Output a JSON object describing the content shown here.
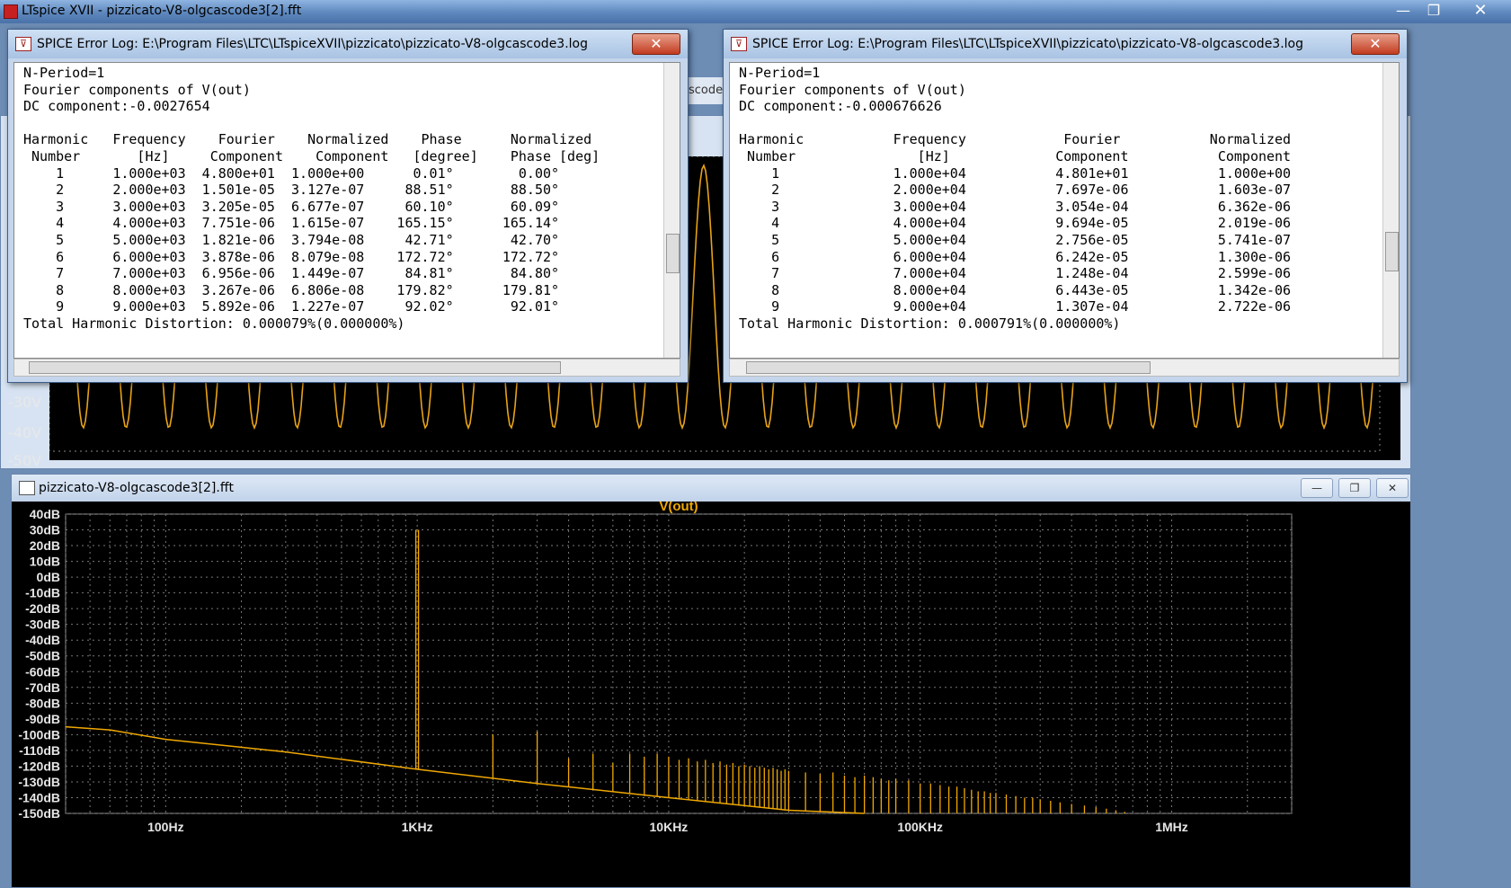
{
  "app": {
    "title": "LTspice XVII - pizzicato-V8-olgcascode3[2].fft",
    "controls": {
      "minimize": "—",
      "maximize": "❐",
      "close": "✕"
    }
  },
  "background_window": {
    "hidden_toolbar_text": "scode",
    "wave_color": "#e8a317",
    "y_labels": [
      "-30V",
      "-40V",
      "-50V"
    ]
  },
  "log_left": {
    "title": "SPICE Error Log: E:\\Program Files\\LTC\\LTspiceXVII\\pizzicato\\pizzicato-V8-olgcascode3.log",
    "close": "✕",
    "text": "N-Period=1\nFourier components of V(out)\nDC component:-0.0027654\n\nHarmonic   Frequency    Fourier    Normalized    Phase      Normalized\n Number       [Hz]     Component    Component   [degree]    Phase [deg]\n    1      1.000e+03  4.800e+01  1.000e+00      0.01°        0.00°\n    2      2.000e+03  1.501e-05  3.127e-07     88.51°       88.50°\n    3      3.000e+03  3.205e-05  6.677e-07     60.10°       60.09°\n    4      4.000e+03  7.751e-06  1.615e-07    165.15°      165.14°\n    5      5.000e+03  1.821e-06  3.794e-08     42.71°       42.70°\n    6      6.000e+03  3.878e-06  8.079e-08    172.72°      172.72°\n    7      7.000e+03  6.956e-06  1.449e-07     84.81°       84.80°\n    8      8.000e+03  3.267e-06  6.806e-08    179.82°      179.81°\n    9      9.000e+03  5.892e-06  1.227e-07     92.02°       92.01°\nTotal Harmonic Distortion: 0.000079%(0.000000%)"
  },
  "log_right": {
    "title": "SPICE Error Log: E:\\Program Files\\LTC\\LTspiceXVII\\pizzicato\\pizzicato-V8-olgcascode3.log",
    "close": "✕",
    "text": "N-Period=1\nFourier components of V(out)\nDC component:-0.000676626\n\nHarmonic           Frequency            Fourier           Normalized\n Number               [Hz]             Component           Component\n    1              1.000e+04           4.801e+01           1.000e+00\n    2              2.000e+04           7.697e-06           1.603e-07\n    3              3.000e+04           3.054e-04           6.362e-06\n    4              4.000e+04           9.694e-05           2.019e-06\n    5              5.000e+04           2.756e-05           5.741e-07\n    6              6.000e+04           6.242e-05           1.300e-06\n    7              7.000e+04           1.248e-04           2.599e-06\n    8              8.000e+04           6.443e-05           1.342e-06\n    9              9.000e+04           1.307e-04           2.722e-06\nTotal Harmonic Distortion: 0.000791%(0.000000%)"
  },
  "fft_window": {
    "title": "pizzicato-V8-olgcascode3[2].fft",
    "controls": {
      "minimize": "—",
      "maximize": "❐",
      "close": "✕"
    }
  },
  "chart_data": {
    "type": "line",
    "title": "V(out)",
    "series": [
      {
        "name": "V(out)",
        "color": "#f0a800"
      }
    ],
    "x_scale": "log",
    "xlim": [
      40,
      3000000
    ],
    "ylim": [
      -150,
      40
    ],
    "x_ticks": [
      {
        "value": 100,
        "label": "100Hz"
      },
      {
        "value": 1000,
        "label": "1KHz"
      },
      {
        "value": 10000,
        "label": "10KHz"
      },
      {
        "value": 100000,
        "label": "100KHz"
      },
      {
        "value": 1000000,
        "label": "1MHz"
      }
    ],
    "y_ticks": [
      {
        "value": 40,
        "label": "40dB"
      },
      {
        "value": 30,
        "label": "30dB"
      },
      {
        "value": 20,
        "label": "20dB"
      },
      {
        "value": 10,
        "label": "10dB"
      },
      {
        "value": 0,
        "label": "0dB"
      },
      {
        "value": -10,
        "label": "-10dB"
      },
      {
        "value": -20,
        "label": "-20dB"
      },
      {
        "value": -30,
        "label": "-30dB"
      },
      {
        "value": -40,
        "label": "-40dB"
      },
      {
        "value": -50,
        "label": "-50dB"
      },
      {
        "value": -60,
        "label": "-60dB"
      },
      {
        "value": -70,
        "label": "-70dB"
      },
      {
        "value": -80,
        "label": "-80dB"
      },
      {
        "value": -90,
        "label": "-90dB"
      },
      {
        "value": -100,
        "label": "-100dB"
      },
      {
        "value": -110,
        "label": "-110dB"
      },
      {
        "value": -120,
        "label": "-120dB"
      },
      {
        "value": -130,
        "label": "-130dB"
      },
      {
        "value": -140,
        "label": "-140dB"
      },
      {
        "value": -150,
        "label": "-150dB"
      }
    ],
    "noise_floor": [
      [
        40,
        -95
      ],
      [
        60,
        -97
      ],
      [
        100,
        -103
      ],
      [
        300,
        -111
      ],
      [
        1000,
        -122
      ],
      [
        3000,
        -131
      ],
      [
        10000,
        -140
      ],
      [
        30000,
        -148
      ],
      [
        60000,
        -150
      ]
    ],
    "fundamental": {
      "x": 1000,
      "y": 30
    },
    "harmonics": [
      [
        2000,
        -100
      ],
      [
        3000,
        -98
      ],
      [
        4000,
        -115
      ],
      [
        5000,
        -112
      ],
      [
        6000,
        -118
      ],
      [
        7000,
        -112
      ],
      [
        8000,
        -114
      ],
      [
        9000,
        -112
      ],
      [
        10000,
        -114
      ],
      [
        11000,
        -116
      ],
      [
        12000,
        -115
      ],
      [
        13000,
        -117
      ],
      [
        14000,
        -116
      ],
      [
        15000,
        -118
      ],
      [
        16000,
        -117
      ],
      [
        17000,
        -119
      ],
      [
        18000,
        -118
      ],
      [
        19000,
        -120
      ],
      [
        20000,
        -119
      ],
      [
        21000,
        -120
      ],
      [
        22000,
        -121
      ],
      [
        23000,
        -120
      ],
      [
        24000,
        -121
      ],
      [
        25000,
        -122
      ],
      [
        26000,
        -121
      ],
      [
        27000,
        -122
      ],
      [
        28000,
        -123
      ],
      [
        29000,
        -122
      ],
      [
        30000,
        -123
      ],
      [
        35000,
        -124
      ],
      [
        40000,
        -125
      ],
      [
        45000,
        -124
      ],
      [
        50000,
        -126
      ],
      [
        55000,
        -127
      ],
      [
        60000,
        -126
      ],
      [
        65000,
        -127
      ],
      [
        70000,
        -128
      ],
      [
        75000,
        -129
      ],
      [
        80000,
        -128
      ],
      [
        90000,
        -129
      ],
      [
        100000,
        -131
      ],
      [
        110000,
        -131
      ],
      [
        120000,
        -132
      ],
      [
        130000,
        -133
      ],
      [
        140000,
        -133
      ],
      [
        150000,
        -134
      ],
      [
        160000,
        -135
      ],
      [
        170000,
        -136
      ],
      [
        180000,
        -136
      ],
      [
        190000,
        -137
      ],
      [
        200000,
        -137
      ],
      [
        220000,
        -138
      ],
      [
        240000,
        -139
      ],
      [
        260000,
        -140
      ],
      [
        280000,
        -140
      ],
      [
        300000,
        -141
      ],
      [
        330000,
        -142
      ],
      [
        360000,
        -143
      ],
      [
        400000,
        -144
      ],
      [
        450000,
        -145
      ],
      [
        500000,
        -146
      ],
      [
        550000,
        -147
      ],
      [
        600000,
        -148
      ],
      [
        650000,
        -149
      ],
      [
        700000,
        -150
      ]
    ],
    "grid": "dashed",
    "background": "#000000"
  }
}
